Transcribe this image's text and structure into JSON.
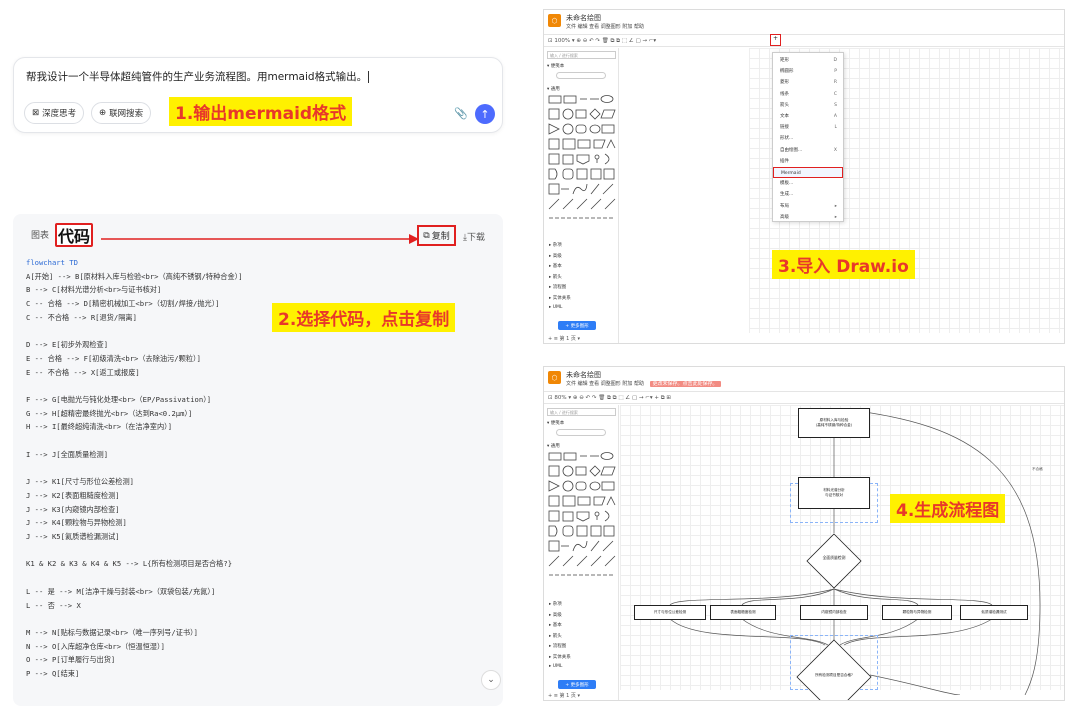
{
  "chat": {
    "prompt": "帮我设计一个半导体超纯管件的生产业务流程图。用mermaid格式输出。",
    "deep_think": "深度思考",
    "web_search": "联网搜索",
    "send": "↑",
    "attach": "📎"
  },
  "annotations": {
    "step1": "1.输出mermaid格式",
    "step2": "2.选择代码，点击复制",
    "step3": "3.导入 Draw.io",
    "step4": "4.生成流程图"
  },
  "code_panel": {
    "tab_chart": "图表",
    "tab_code": "代码",
    "copy": "复制",
    "download": "下载",
    "lines": [
      "flowchart TD",
      "    A[开始] --> B[原材料入库与检验<br>（高纯不锈钢/特种合金）]",
      "    B --> C[材料光谱分析<br>与证书核对]",
      "    C -- 合格 --> D[精密机械加工<br>（切割/焊接/抛光）]",
      "    C -- 不合格 --> R[退货/隔离]",
      "",
      "    D --> E[初步外观检查]",
      "    E -- 合格 --> F[初级清洗<br>（去除油污/颗粒）]",
      "    E -- 不合格 --> X[返工或报废]",
      "",
      "    F --> G[电抛光与钝化处理<br>（EP/Passivation）]",
      "    G --> H[超精密最终抛光<br>（达到Ra<0.2μm）]",
      "    H --> I[最终超纯清洗<br>（在洁净室内）]",
      "",
      "    I --> J[全面质量检测]",
      "",
      "    J --> K1[尺寸与形位公差检测]",
      "    J --> K2[表面粗糙度检测]",
      "    J --> K3[内窥镜内部检查]",
      "    J --> K4[颗粒物与异物检测]",
      "    J --> K5[氦质谱检漏测试]",
      "",
      "    K1 & K2 & K3 & K4 & K5 --> L{所有检测项目是否合格?}",
      "",
      "    L -- 是 --> M[洁净干燥与封装<br>（双袋包装/充氮）]",
      "    L -- 否 --> X",
      "",
      "    M --> N[贴标与数据记录<br>（唯一序列号/证书）]",
      "    N --> O[入库超净仓库<br>（恒温恒湿）]",
      "    O --> P[订单履行与出货]",
      "    P --> Q[结束]"
    ]
  },
  "drawio1": {
    "title": "未命名绘图",
    "menus": "文件  编辑  查看  调整图形  附加  帮助",
    "toolbar": "⊡   100% ▾   ⊕  ⊖   ↶  ↷   🗑   ⧉  ⧉   ⬚  ∠  ▢   →  ⌐▾",
    "search": "输入 / 进行搜索",
    "scratch": "▾ 便笺本",
    "general": "▾ 通用",
    "libs": [
      "▸ 杂项",
      "▸ 高级",
      "▸ 基本",
      "▸ 箭头",
      "▸ 流程图",
      "▸ 实体关系",
      "▸ UML"
    ],
    "more_shapes": "+ 更多图形",
    "pages": "+  ≡   第 1 页 ▾",
    "menu": [
      {
        "l": "矩形",
        "s": "D"
      },
      {
        "l": "椭圆形",
        "s": "P"
      },
      {
        "l": "菱形",
        "s": "R"
      },
      {
        "l": "线条",
        "s": "C"
      },
      {
        "l": "箭头",
        "s": "S"
      },
      {
        "l": "文本",
        "s": "A"
      },
      {
        "l": "链接",
        "s": "L"
      },
      {
        "l": "形状...",
        "s": ""
      },
      {
        "l": "自由绘图...",
        "s": "X"
      },
      {
        "l": "插件",
        "s": ""
      },
      {
        "l": "Mermaid",
        "s": ""
      },
      {
        "l": "模板...",
        "s": ""
      },
      {
        "l": "生成...",
        "s": ""
      },
      {
        "l": "布局",
        "s": "▸"
      },
      {
        "l": "高级",
        "s": "▸"
      }
    ]
  },
  "drawio2": {
    "title": "未命名绘图",
    "menus": "文件  编辑  查看  调整图形  附加  帮助",
    "badge": "更改未保存。点击此处保存。",
    "toolbar": "⊡   80% ▾   ⊕  ⊖   ↶  ↷   🗑   ⧉  ⧉   ⬚  ∠  ▢   →  ⌐▾   +  ⧉  ⊞",
    "nodes": {
      "n1": "原材料入库与检验\n(高纯不锈钢/特种合金)",
      "n2": "材料光谱分析\n与证书核对",
      "n3": "全面质量检测",
      "k1": "尺寸与形位公差检测",
      "k2": "表面粗糙度检测",
      "k3": "内窥镜内部检查",
      "k4": "颗粒物与异物检测",
      "k5": "氦质谱检漏测试",
      "n4": "所有检测项目是否合格?"
    },
    "side_label": "不合格"
  }
}
